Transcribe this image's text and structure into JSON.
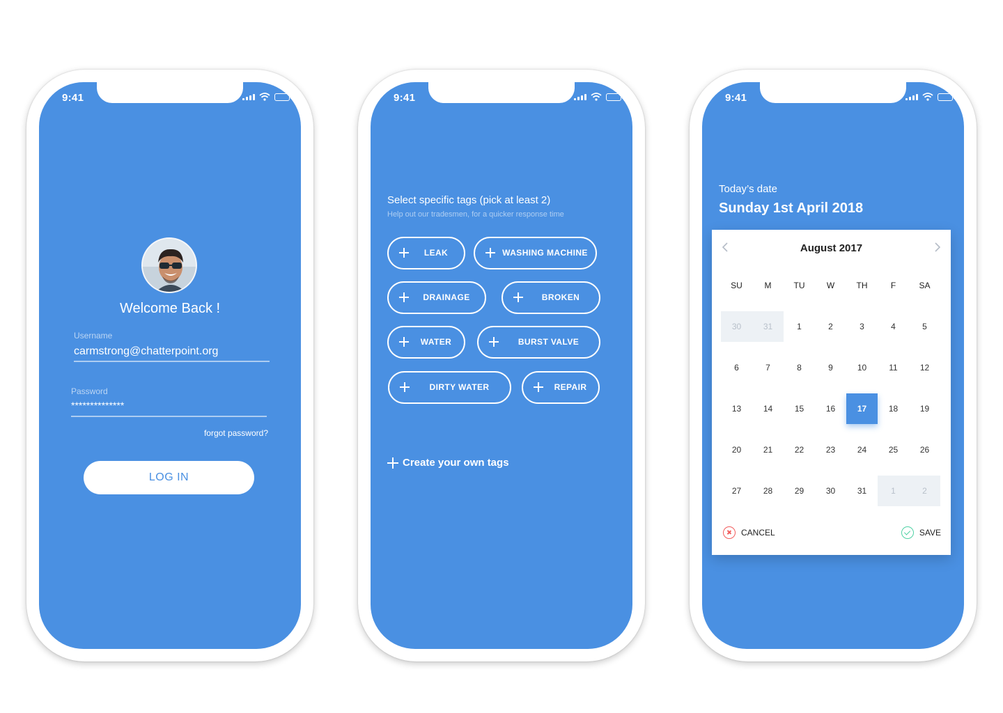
{
  "status_bar": {
    "time": "9:41"
  },
  "login": {
    "welcome": "Welcome Back !",
    "username_label": "Username",
    "username_value": "carmstrong@chatterpoint.org",
    "password_label": "Password",
    "password_value": "**************",
    "forgot_password": "forgot password?",
    "login_button": "LOG IN"
  },
  "tags": {
    "title": "Select specific tags (pick at least 2)",
    "subtitle": "Help out our tradesmen, for a quicker response time",
    "items": [
      {
        "label": "LEAK"
      },
      {
        "label": "WASHING MACHINE"
      },
      {
        "label": "DRAINAGE"
      },
      {
        "label": "BROKEN"
      },
      {
        "label": "WATER"
      },
      {
        "label": "BURST VALVE"
      },
      {
        "label": "DIRTY WATER"
      },
      {
        "label": "REPAIR"
      }
    ],
    "create_own": "Create your own tags"
  },
  "calendar": {
    "today_label": "Today’s date",
    "today_value": "Sunday 1st April 2018",
    "month": "August 2017",
    "prev_icon": "chevron-left-icon",
    "next_icon": "chevron-right-icon",
    "weekdays": [
      "SU",
      "M",
      "TU",
      "W",
      "TH",
      "F",
      "SA"
    ],
    "days": [
      {
        "label": "30",
        "muted": true
      },
      {
        "label": "31",
        "muted": true
      },
      {
        "label": "1"
      },
      {
        "label": "2"
      },
      {
        "label": "3"
      },
      {
        "label": "4"
      },
      {
        "label": "5"
      },
      {
        "label": "6"
      },
      {
        "label": "7"
      },
      {
        "label": "8"
      },
      {
        "label": "9"
      },
      {
        "label": "10"
      },
      {
        "label": "11"
      },
      {
        "label": "12"
      },
      {
        "label": "13"
      },
      {
        "label": "14"
      },
      {
        "label": "15"
      },
      {
        "label": "16"
      },
      {
        "label": "17",
        "selected": true
      },
      {
        "label": "18"
      },
      {
        "label": "19"
      },
      {
        "label": "20"
      },
      {
        "label": "21"
      },
      {
        "label": "22"
      },
      {
        "label": "23"
      },
      {
        "label": "24"
      },
      {
        "label": "25"
      },
      {
        "label": "26"
      },
      {
        "label": "27"
      },
      {
        "label": "28"
      },
      {
        "label": "29"
      },
      {
        "label": "30"
      },
      {
        "label": "31"
      },
      {
        "label": "1",
        "muted": true
      },
      {
        "label": "2",
        "muted": true
      }
    ],
    "cancel_label": "CANCEL",
    "save_label": "SAVE"
  },
  "colors": {
    "primary": "#4a90e2",
    "cancel": "#f25c5c",
    "save": "#4fd1a5"
  }
}
